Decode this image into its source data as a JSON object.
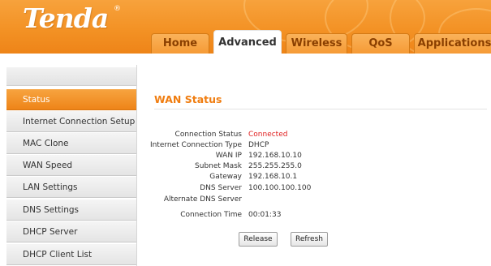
{
  "header": {
    "logo_text": "Tenda",
    "logo_mark": "®"
  },
  "tabs": [
    {
      "label": "Home"
    },
    {
      "label": "Advanced",
      "active": true
    },
    {
      "label": "Wireless"
    },
    {
      "label": "QoS"
    },
    {
      "label": "Applications"
    }
  ],
  "sidebar": {
    "items": [
      {
        "label": "Status",
        "active": true
      },
      {
        "label": "Internet Connection Setup"
      },
      {
        "label": "MAC Clone"
      },
      {
        "label": "WAN Speed"
      },
      {
        "label": "LAN Settings"
      },
      {
        "label": "DNS Settings"
      },
      {
        "label": "DHCP Server"
      },
      {
        "label": "DHCP Client List"
      }
    ]
  },
  "wan_status": {
    "title": "WAN Status",
    "rows": [
      {
        "label": "Connection Status",
        "value": "Connected"
      },
      {
        "label": "Internet Connection Type",
        "value": "DHCP"
      },
      {
        "label": "WAN IP",
        "value": "192.168.10.10"
      },
      {
        "label": "Subnet Mask",
        "value": "255.255.255.0"
      },
      {
        "label": "Gateway",
        "value": "192.168.10.1"
      },
      {
        "label": "DNS Server",
        "value": "100.100.100.100"
      },
      {
        "label": "Alternate DNS Server",
        "value": ""
      },
      {
        "label": "Connection Time",
        "value": "00:01:33"
      }
    ],
    "release_label": "Release",
    "refresh_label": "Refresh"
  },
  "colors": {
    "brand_orange": "#f39225",
    "title_orange": "#f07d10",
    "status_connected": "#e02020"
  }
}
